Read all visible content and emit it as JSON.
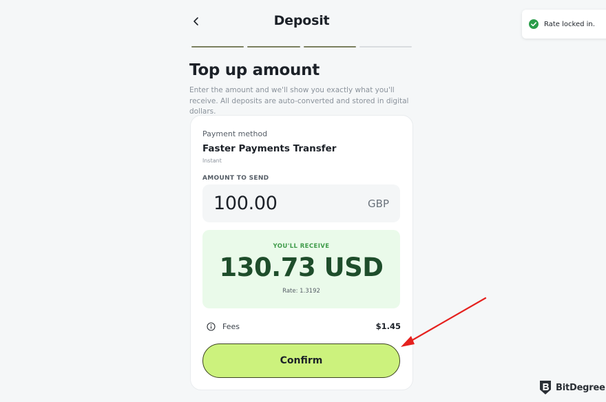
{
  "header": {
    "title": "Deposit",
    "back_icon": "chevron-left-icon"
  },
  "progress": {
    "total_steps": 4,
    "completed_steps": 3,
    "active_color": "#7a7f5e",
    "inactive_color": "#d9dcdf"
  },
  "form": {
    "heading": "Top up amount",
    "description": "Enter the amount and we'll show you exactly what you'll receive. All deposits are auto-converted and stored in digital dollars."
  },
  "payment_method": {
    "label": "Payment method",
    "name": "Faster Payments Transfer",
    "speed": "Instant"
  },
  "amount": {
    "label": "AMOUNT TO SEND",
    "value": "100.00",
    "currency": "GBP"
  },
  "receive": {
    "label": "YOU'LL RECEIVE",
    "amount": "130.73 USD",
    "rate": "Rate: 1.3192"
  },
  "fees": {
    "icon": "info-icon",
    "label": "Fees",
    "value": "$1.45"
  },
  "actions": {
    "confirm_label": "Confirm",
    "confirm_color": "#ccf27d"
  },
  "toast": {
    "icon": "check-circle-icon",
    "message": "Rate locked in.",
    "color": "#2a9d4a"
  },
  "annotation": {
    "arrow_color": "#e5211e"
  },
  "watermark": {
    "logo": "bitdegree-shield-logo",
    "text": "BitDegree"
  }
}
